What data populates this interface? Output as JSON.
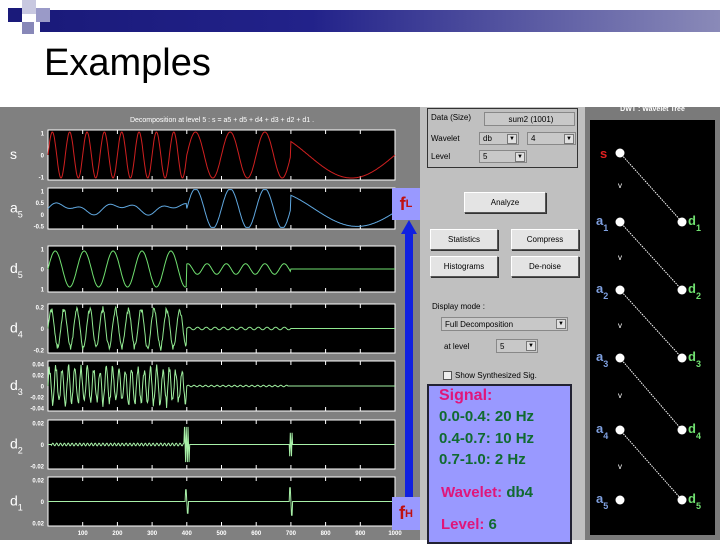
{
  "slide": {
    "title": "Examples"
  },
  "plots": {
    "title": "Decomposition at level 5 : s = a5 + d5 + d4 + d3 + d2 + d1 .",
    "panels": [
      {
        "name": "s",
        "sub": "",
        "ticks": [
          "1",
          "0",
          "-1"
        ]
      },
      {
        "name": "a",
        "sub": "5",
        "ticks": [
          "1",
          "0.5",
          "0",
          "-0.5"
        ]
      },
      {
        "name": "d",
        "sub": "5",
        "ticks": [
          "1",
          "0",
          "1"
        ]
      },
      {
        "name": "d",
        "sub": "4",
        "ticks": [
          "0.2",
          "0",
          "-0.2"
        ]
      },
      {
        "name": "d",
        "sub": "3",
        "ticks": [
          "0.04",
          "0.02",
          "0",
          "-0.02",
          "-0.04"
        ]
      },
      {
        "name": "d",
        "sub": "2",
        "ticks": [
          "0.02",
          "0",
          "-0.02"
        ]
      },
      {
        "name": "d",
        "sub": "1",
        "ticks": [
          "0.02",
          "0",
          "0.02"
        ]
      }
    ],
    "xticks": [
      "100",
      "200",
      "300",
      "400",
      "500",
      "600",
      "700",
      "800",
      "900",
      "1000"
    ]
  },
  "markers": {
    "fl": "f",
    "fl_sub": "L",
    "fh": "f",
    "fh_sub": "H"
  },
  "controls": {
    "data_label": "Data (Size)",
    "data_value": "sum2 (1001)",
    "wavelet_label": "Wavelet",
    "wavelet_family": "db",
    "wavelet_order": "4",
    "level_label": "Level",
    "level_value": "5",
    "analyze": "Analyze",
    "statistics": "Statistics",
    "compress": "Compress",
    "histograms": "Histograms",
    "denoise": "De-noise",
    "display_mode_label": "Display mode :",
    "display_mode": "Full Decomposition",
    "at_level_label": "at level",
    "at_level": "5",
    "show_synth": "Show Synthesized Sig.",
    "dropdown_arrow": "▼"
  },
  "info": {
    "signal_label": "Signal:",
    "lines": [
      "0.0-0.4:  20 Hz",
      "0.4-0.7: 10 Hz",
      "0.7-1.0: 2 Hz"
    ],
    "wavelet_label": "Wavelet:",
    "wavelet": "db4",
    "level_label": "Level:",
    "level": "6"
  },
  "tree": {
    "title": "DWT : Wavelet Tree",
    "root": "s",
    "approx": [
      {
        "n": "a",
        "s": "1"
      },
      {
        "n": "a",
        "s": "2"
      },
      {
        "n": "a",
        "s": "3"
      },
      {
        "n": "a",
        "s": "4"
      },
      {
        "n": "a",
        "s": "5"
      }
    ],
    "detail": [
      {
        "n": "d",
        "s": "1"
      },
      {
        "n": "d",
        "s": "2"
      },
      {
        "n": "d",
        "s": "3"
      },
      {
        "n": "d",
        "s": "4"
      },
      {
        "n": "d",
        "s": "5"
      }
    ],
    "colors": {
      "root": "#e02020",
      "approx": "#7fa0e0",
      "detail": "#70e070"
    }
  }
}
